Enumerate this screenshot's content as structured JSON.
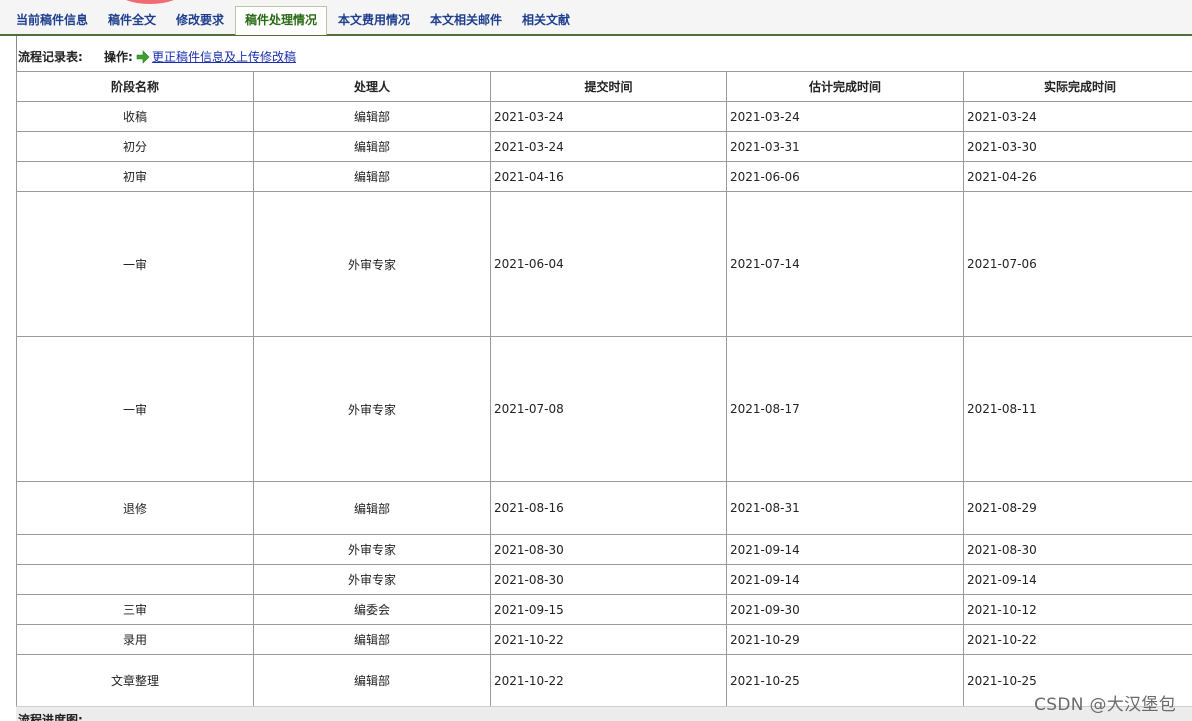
{
  "tabs": [
    {
      "label": "当前稿件信息",
      "active": false
    },
    {
      "label": "稿件全文",
      "active": false
    },
    {
      "label": "修改要求",
      "active": false
    },
    {
      "label": "稿件处理情况",
      "active": true
    },
    {
      "label": "本文费用情况",
      "active": false
    },
    {
      "label": "本文相关邮件",
      "active": false
    },
    {
      "label": "相关文献",
      "active": false
    }
  ],
  "flow": {
    "record_label": "流程记录表:",
    "ops_label": "操作:",
    "ops_icon": "green-arrow-right-icon",
    "ops_link": "更正稿件信息及上传修改稿"
  },
  "table": {
    "headers": [
      "阶段名称",
      "处理人",
      "提交时间",
      "估计完成时间",
      "实际完成时间"
    ],
    "rows": [
      {
        "stage": "收稿",
        "handler": "编辑部",
        "submitted": "2021-03-24",
        "estimated": "2021-03-24",
        "actual": "2021-03-24"
      },
      {
        "stage": "初分",
        "handler": "编辑部",
        "submitted": "2021-03-24",
        "estimated": "2021-03-31",
        "actual": "2021-03-30"
      },
      {
        "stage": "初审",
        "handler": "编辑部",
        "submitted": "2021-04-16",
        "estimated": "2021-06-06",
        "actual": "2021-04-26"
      },
      {
        "stage": "一审",
        "handler": "外审专家",
        "submitted": "2021-06-04",
        "estimated": "2021-07-14",
        "actual": "2021-07-06"
      },
      {
        "stage": "一审",
        "handler": "外审专家",
        "submitted": "2021-07-08",
        "estimated": "2021-08-17",
        "actual": "2021-08-11"
      },
      {
        "stage": "退修",
        "handler": "编辑部",
        "submitted": "2021-08-16",
        "estimated": "2021-08-31",
        "actual": "2021-08-29"
      },
      {
        "stage": "",
        "handler": "外审专家",
        "submitted": "2021-08-30",
        "estimated": "2021-09-14",
        "actual": "2021-08-30"
      },
      {
        "stage": "",
        "handler": "外审专家",
        "submitted": "2021-08-30",
        "estimated": "2021-09-14",
        "actual": "2021-09-14"
      },
      {
        "stage": "三审",
        "handler": "编委会",
        "submitted": "2021-09-15",
        "estimated": "2021-09-30",
        "actual": "2021-10-12"
      },
      {
        "stage": "录用",
        "handler": "编辑部",
        "submitted": "2021-10-22",
        "estimated": "2021-10-29",
        "actual": "2021-10-22"
      },
      {
        "stage": "文章整理",
        "handler": "编辑部",
        "submitted": "2021-10-22",
        "estimated": "2021-10-25",
        "actual": "2021-10-25"
      }
    ]
  },
  "footer": {
    "label": "流程进度图:"
  },
  "watermark": "CSDN @大汉堡包",
  "colors": {
    "tab_text": "#1e3f8f",
    "active_tab_text": "#2a6a14",
    "link": "#1a2fb0",
    "arrow": "#3aa32f",
    "red_mark": "#f16b73"
  }
}
